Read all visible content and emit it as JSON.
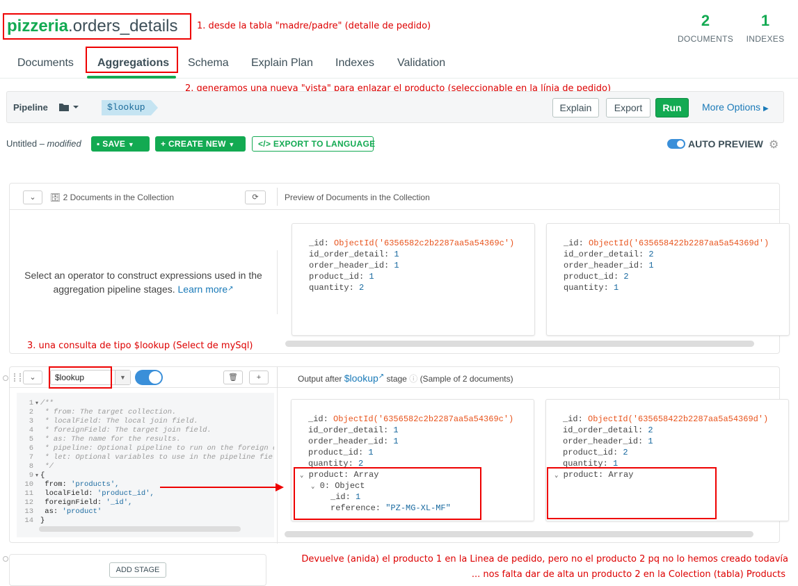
{
  "header": {
    "db_name": "pizzeria",
    "collection_name": ".orders_details",
    "documents_count": "2",
    "documents_label": "DOCUMENTS",
    "indexes_count": "1",
    "indexes_label": "INDEXES"
  },
  "tabs": [
    {
      "label": "Documents"
    },
    {
      "label": "Aggregations"
    },
    {
      "label": "Schema"
    },
    {
      "label": "Explain Plan"
    },
    {
      "label": "Indexes"
    },
    {
      "label": "Validation"
    }
  ],
  "annotations": {
    "a1": "1. desde la tabla \"madre/padre\" (detalle de pedido)",
    "a2": "2. generamos una nueva \"vista\" para enlazar el producto (seleccionable en la línia de pedido)",
    "a3": "3. una consulta de tipo $lookup (Select de mySql)",
    "a4": "Devuelve (anida) el producto 1 en la Linea de pedido, pero no el producto 2 pq no lo hemos creado todavía",
    "a5": "... nos falta dar de alta un producto 2 en la Colection (tabla) Products"
  },
  "pipeline_bar": {
    "label": "Pipeline",
    "stage_chip": "$lookup",
    "explain": "Explain",
    "export": "Export",
    "run": "Run",
    "more_options": "More Options"
  },
  "toolbar": {
    "name": "Untitled",
    "dash": " – ",
    "modified": "modified",
    "save": "SAVE",
    "create_new": "CREATE NEW",
    "export_to_language": "EXPORT TO LANGUAGE",
    "auto_preview": "AUTO PREVIEW"
  },
  "collection_panel": {
    "count_label": "2 Documents in the Collection",
    "preview_label": "Preview of Documents in the Collection",
    "help_line1": "Select an operator to construct expressions used in the",
    "help_line2": "aggregation pipeline stages.",
    "learn_more": "Learn more"
  },
  "preview_docs": [
    {
      "id": "ObjectId('6356582c2b2287aa5a54369c')",
      "id_order_detail": "1",
      "order_header_id": "1",
      "product_id": "1",
      "quantity": "2"
    },
    {
      "id": "ObjectId('635658422b2287aa5a54369d')",
      "id_order_detail": "2",
      "order_header_id": "1",
      "product_id": "2",
      "quantity": "1"
    }
  ],
  "fields": {
    "id": "_id:",
    "id_order_detail": "id_order_detail:",
    "order_header_id": "order_header_id:",
    "product_id": "product_id:",
    "quantity": "quantity:",
    "product": "product:",
    "array": "Array",
    "zero_object": "0: Object",
    "reference": "reference:"
  },
  "lookup_stage": {
    "operator": "$lookup",
    "output_prefix": "Output after",
    "output_operator": "$lookup",
    "output_stage": "stage",
    "sample_note": "(Sample of 2 documents)",
    "doc1_product_id": "1",
    "doc1_reference": "\"PZ-MG-XL-MF\""
  },
  "code": [
    {
      "n": "1",
      "fold": "▾",
      "t": "/**"
    },
    {
      "n": "2",
      "fold": "",
      "t": " * from: The target collection."
    },
    {
      "n": "3",
      "fold": "",
      "t": " * localField: The local join field."
    },
    {
      "n": "4",
      "fold": "",
      "t": " * foreignField: The target join field."
    },
    {
      "n": "5",
      "fold": "",
      "t": " * as: The name for the results."
    },
    {
      "n": "6",
      "fold": "",
      "t": " * pipeline: Optional pipeline to run on the foreign collection."
    },
    {
      "n": "7",
      "fold": "",
      "t": " * let: Optional variables to use in the pipeline field stages."
    },
    {
      "n": "8",
      "fold": "",
      "t": " */"
    },
    {
      "n": "9",
      "fold": "▾",
      "t": "{"
    },
    {
      "n": "10",
      "fold": "",
      "k": "  from: ",
      "v": "'products',"
    },
    {
      "n": "11",
      "fold": "",
      "k": "  localField: ",
      "v": "'product_id',"
    },
    {
      "n": "12",
      "fold": "",
      "k": "  foreignField: ",
      "v": "'_id',"
    },
    {
      "n": "13",
      "fold": "",
      "k": "  as: ",
      "v": "'product'"
    },
    {
      "n": "14",
      "fold": "",
      "t": "}"
    }
  ],
  "add_stage": "ADD STAGE"
}
